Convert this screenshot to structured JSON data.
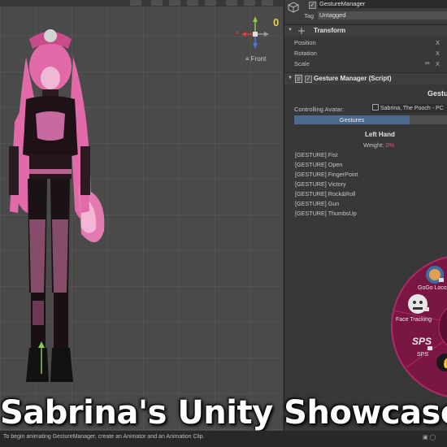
{
  "scene": {
    "gizmo_axis_x": "x",
    "gizmo_zero": "0",
    "view_label": "Front"
  },
  "inspector": {
    "object_name": "GestureManager",
    "tag_label": "Tag",
    "tag_value": "Untagged",
    "transform": {
      "title": "Transform",
      "position_label": "Position",
      "rotation_label": "Rotation",
      "scale_label": "Scale",
      "position_axis": "X",
      "rotation_axis": "X",
      "scale_axis": "X"
    },
    "gesture_manager": {
      "title": "Gesture Manager (Script)",
      "header": "Gestu",
      "controlling_label": "Controlling Avatar:",
      "controlling_value": "Sabrina, The Pooch - PC",
      "tab_gestures": "Gestures",
      "left_hand": "Left Hand",
      "weight_label": "Weight:",
      "weight_value": "0%",
      "gestures": [
        "[GESTURE] Fist",
        "[GESTURE] Open",
        "[GESTURE] FingerPoint",
        "[GESTURE] Victory",
        "[GESTURE] Rock&Roll",
        "[GESTURE] Gun",
        "[GESTURE] ThumbsUp"
      ]
    },
    "radial_menu": {
      "items": [
        "GoGo Loco",
        "Face Tracking",
        "SPS"
      ],
      "sps_badge": "SPS"
    }
  },
  "overlay": {
    "title": "Sabrina's Unity Showcase"
  },
  "status_bar": {
    "message": "To begin animating GestureManager, create an Animator and an Animation Clip."
  },
  "colors": {
    "accent_blue": "#4a6a90",
    "weight_pink": "#e0557a",
    "radial_magenta": "#8a1a4a",
    "gizmo_yellow": "#e8d43a"
  }
}
